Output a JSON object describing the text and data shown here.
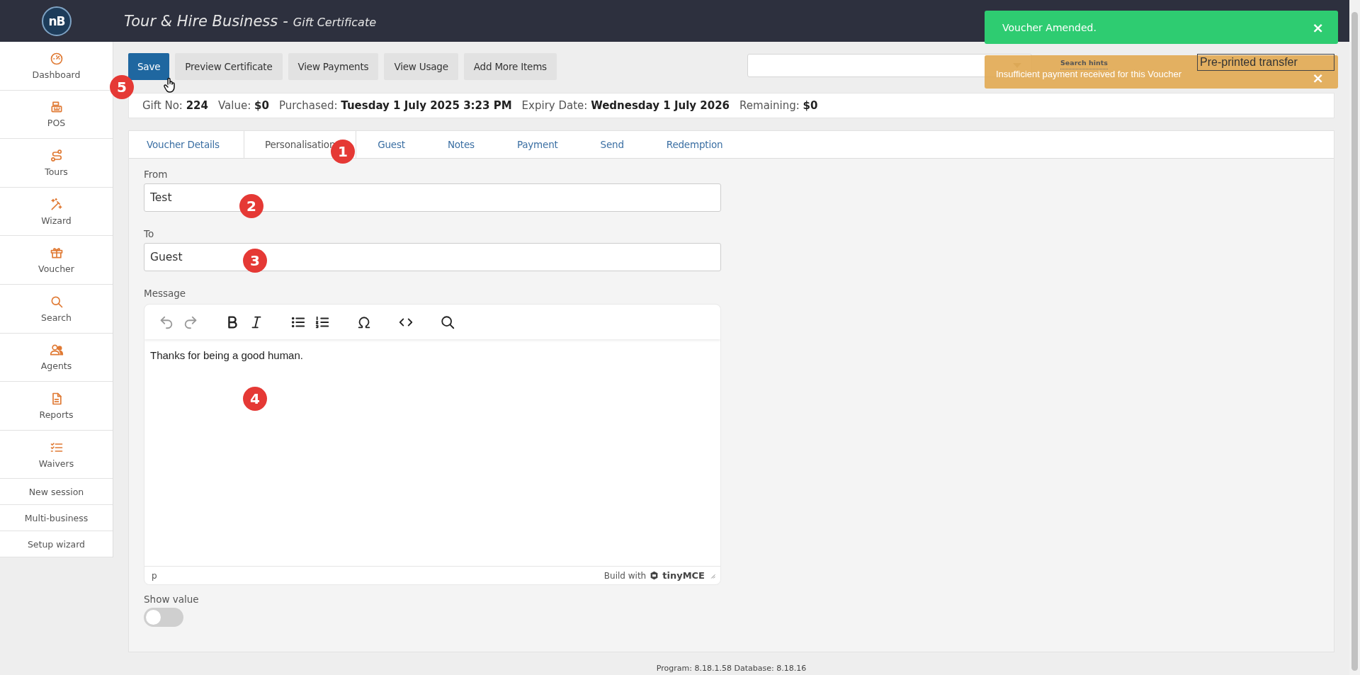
{
  "header": {
    "logo": "nB",
    "title": "Tour & Hire Business",
    "separator": "-",
    "subtitle": "Gift Certificate"
  },
  "sidebar": {
    "items": [
      {
        "label": "Dashboard"
      },
      {
        "label": "POS"
      },
      {
        "label": "Tours"
      },
      {
        "label": "Wizard"
      },
      {
        "label": "Voucher"
      },
      {
        "label": "Search"
      },
      {
        "label": "Agents"
      },
      {
        "label": "Reports"
      },
      {
        "label": "Waivers"
      }
    ],
    "links": [
      "New session",
      "Multi-business",
      "Setup wizard"
    ]
  },
  "toolbar": {
    "buttons": [
      {
        "label": "Save",
        "kind": "primary"
      },
      {
        "label": "Preview Certificate",
        "kind": "default"
      },
      {
        "label": "View Payments",
        "kind": "default"
      },
      {
        "label": "View Usage",
        "kind": "default"
      },
      {
        "label": "Add More Items",
        "kind": "default"
      }
    ],
    "search_hints": "Search hints",
    "transfer_field": {
      "value": "Pre-printed transfer"
    }
  },
  "notifications": [
    {
      "kind": "success",
      "text": "Voucher Amended.",
      "close": "×"
    },
    {
      "kind": "warning",
      "text": "Insufficient payment received for this Voucher",
      "close": "×"
    }
  ],
  "summary": [
    "Gift No: **224**",
    "Value: **$0**",
    "Purchased: **Tuesday 1 July 2025 3:23 PM**",
    "Expiry Date: **Wednesday 1 July 2026**",
    "Remaining: **$0**"
  ],
  "tabs": [
    {
      "label": "Voucher Details",
      "selected": false
    },
    {
      "label": "Personalisation",
      "selected": true
    },
    {
      "label": "Guest",
      "selected": false
    },
    {
      "label": "Notes",
      "selected": false
    },
    {
      "label": "Payment",
      "selected": false
    },
    {
      "label": "Send",
      "selected": false
    },
    {
      "label": "Redemption",
      "selected": false
    }
  ],
  "form": {
    "from": {
      "label": "From",
      "value": "Test"
    },
    "to": {
      "label": "To",
      "value": "Guest"
    },
    "message": {
      "label": "Message",
      "text": "Thanks for being a good human.",
      "element_path": "p",
      "branding": "Build with",
      "brand": "tinyMCE"
    },
    "show_value": {
      "label": "Show value",
      "on": false
    }
  },
  "annotations": [
    {
      "number": "1"
    },
    {
      "number": "2"
    },
    {
      "number": "3"
    },
    {
      "number": "4"
    },
    {
      "number": "5"
    }
  ],
  "footer": "Program: 8.18.1.58 Database: 8.18.16"
}
